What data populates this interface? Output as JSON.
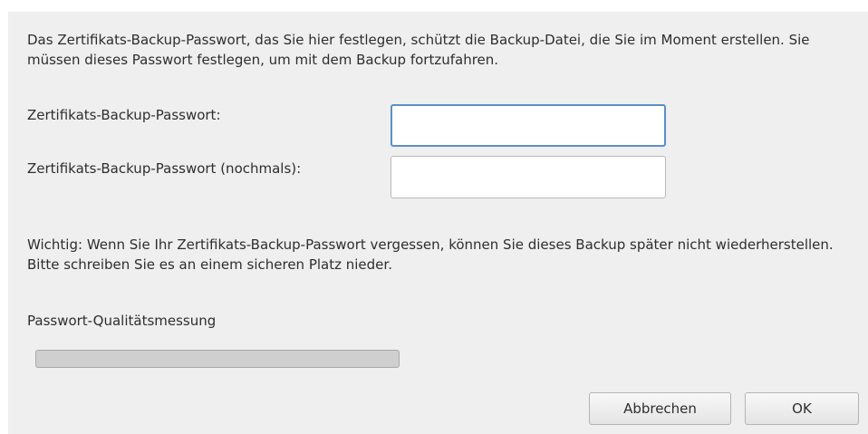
{
  "dialog": {
    "intro": "Das Zertifikats-Backup-Passwort, das Sie hier festlegen, schützt die Backup-Datei, die Sie im Moment erstellen. Sie müssen dieses Passwort festlegen, um mit dem Backup fortzufahren.",
    "password_label": "Zertifikats-Backup-Passwort:",
    "password_value": "",
    "confirm_label": "Zertifikats-Backup-Passwort (nochmals):",
    "confirm_value": "",
    "warning": "Wichtig: Wenn Sie Ihr Zertifikats-Backup-Passwort vergessen, können Sie dieses Backup später nicht wiederherstellen. Bitte schreiben Sie es an einem sicheren Platz nieder.",
    "quality_label": "Passwort-Qualitätsmessung",
    "quality_level": 0,
    "cancel_label": "Abbrechen",
    "ok_label": "OK"
  },
  "colors": {
    "dialog_background": "#efefef",
    "focus_border": "#5b8fc9",
    "meter_background": "#cfcfcf"
  }
}
